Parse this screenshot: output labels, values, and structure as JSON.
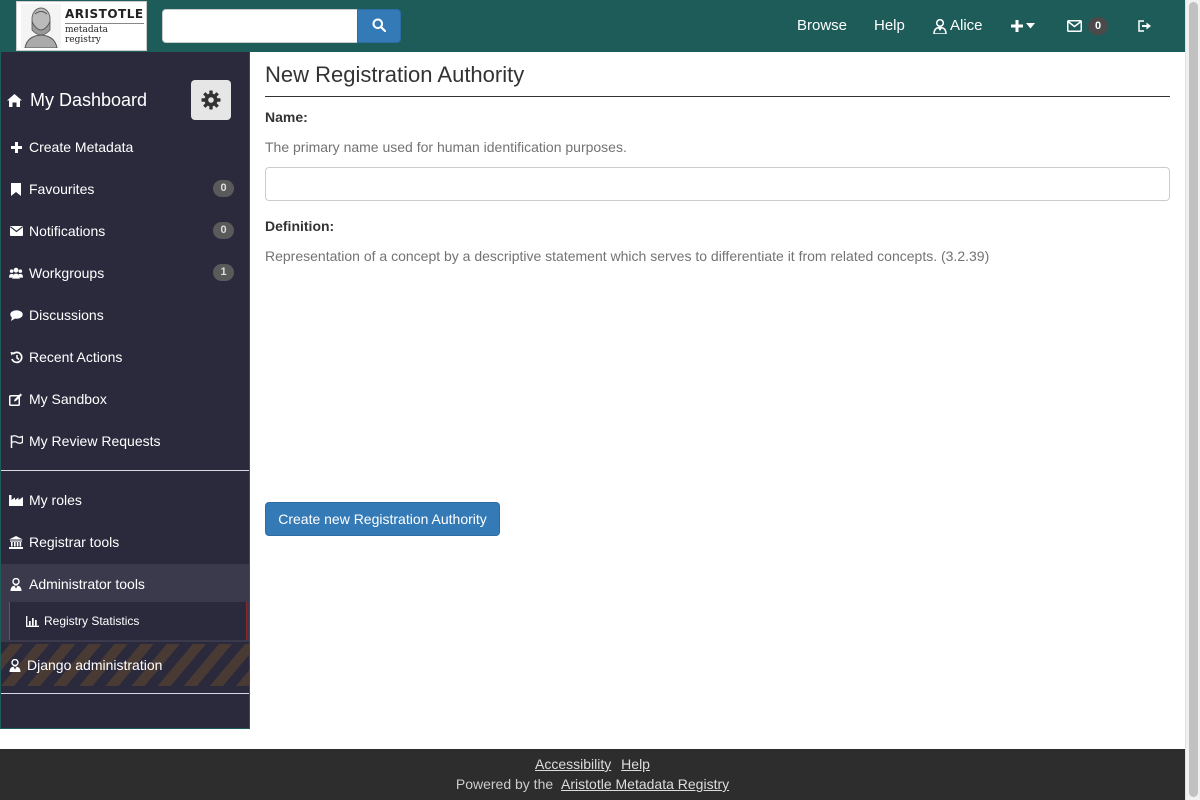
{
  "header": {
    "logo": {
      "title": "ARISTOTLE",
      "subtitle": "metadata registry"
    },
    "search": {
      "value": "",
      "placeholder": ""
    },
    "nav": {
      "browse": "Browse",
      "help": "Help",
      "user": "Alice",
      "mail_count": "0"
    }
  },
  "sidebar": {
    "dashboard": "My Dashboard",
    "items": [
      {
        "label": "Create Metadata"
      },
      {
        "label": "Favourites",
        "badge": "0"
      },
      {
        "label": "Notifications",
        "badge": "0"
      },
      {
        "label": "Workgroups",
        "badge": "1"
      },
      {
        "label": "Discussions"
      },
      {
        "label": "Recent Actions"
      },
      {
        "label": "My Sandbox"
      },
      {
        "label": "My Review Requests"
      },
      {
        "label": "My roles"
      },
      {
        "label": "Registrar tools"
      },
      {
        "label": "Administrator tools"
      }
    ],
    "admin_sub": {
      "label": "Registry Statistics"
    },
    "django": {
      "label": "Django administration"
    }
  },
  "main": {
    "title": "New Registration Authority",
    "name_field": {
      "label": "Name:",
      "help": "The primary name used for human identification purposes.",
      "value": ""
    },
    "definition_field": {
      "label": "Definition:",
      "help": "Representation of a concept by a descriptive statement which serves to differentiate it from related concepts. (3.2.39)"
    },
    "submit_label": "Create new Registration Authority"
  },
  "footer": {
    "accessibility": "Accessibility",
    "help": "Help",
    "powered_prefix": "Powered by the",
    "registry_link": "Aristotle Metadata Registry"
  }
}
